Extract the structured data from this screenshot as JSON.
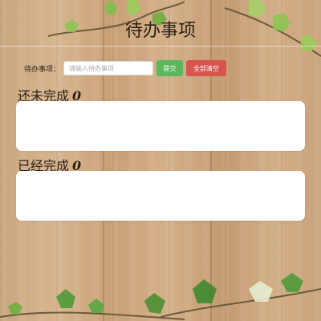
{
  "header": {
    "title": "待办事项"
  },
  "form": {
    "label": "待办事项：",
    "placeholder": "请输入待办事项",
    "value": "",
    "submit_label": "提交",
    "clear_label": "全部清空"
  },
  "sections": {
    "pending": {
      "label": "还未完成",
      "count": "0",
      "items": []
    },
    "done": {
      "label": "已经完成",
      "count": "0",
      "items": []
    }
  },
  "colors": {
    "submit_button": "#5cb85c",
    "clear_button": "#d9534f",
    "list_background": "#ffffff"
  },
  "background": {
    "decorations": [
      "wood-plank-background",
      "ivy-leaves"
    ]
  }
}
